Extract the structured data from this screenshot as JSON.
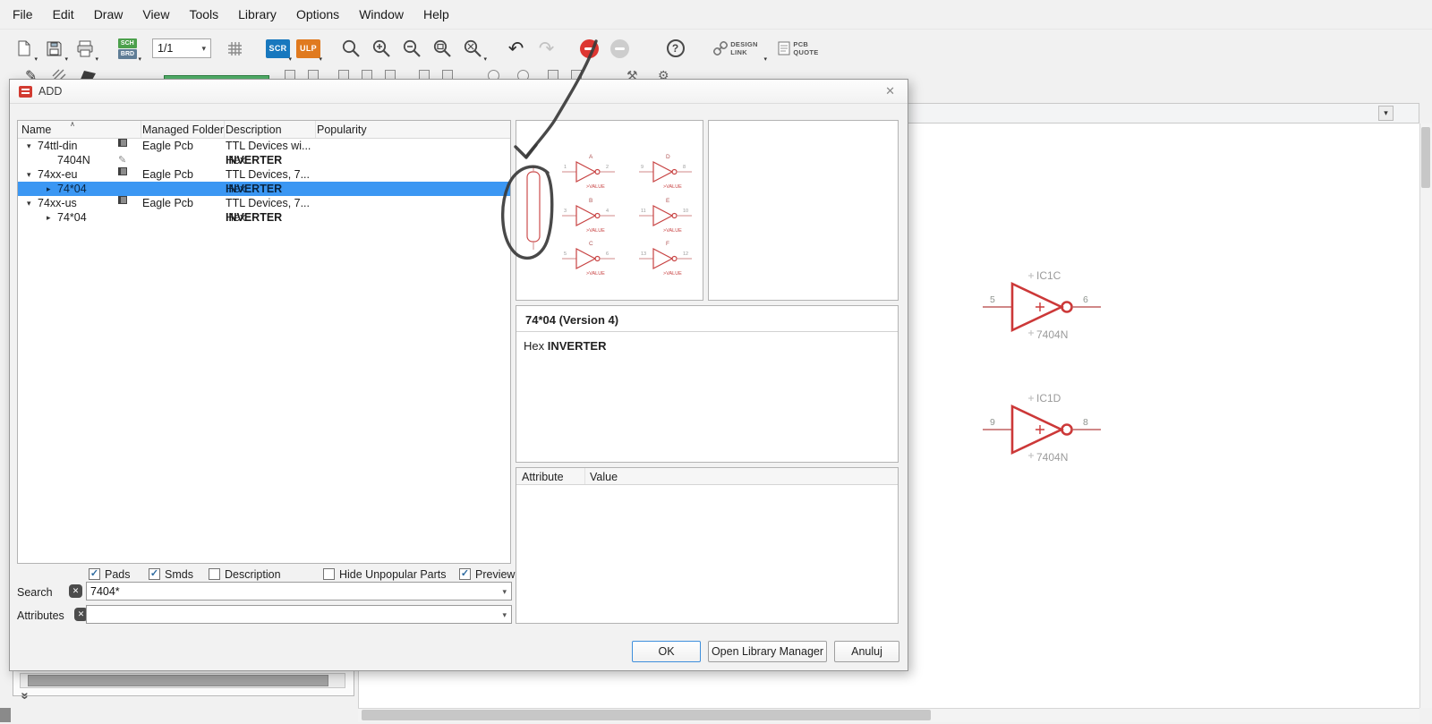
{
  "icons": {
    "dropdown": "▾",
    "close": "✕",
    "clear": "✕",
    "help": "?",
    "undo": "↶",
    "redo": "↷",
    "pencil": "✎",
    "sort": "∧",
    "collapse": "»",
    "check": "✓"
  },
  "menubar": {
    "items": [
      "File",
      "Edit",
      "Draw",
      "View",
      "Tools",
      "Library",
      "Options",
      "Window",
      "Help"
    ]
  },
  "toolbar": {
    "sheet_selector": "1/1",
    "sch_badge": "SCH",
    "brd_badge": "BRD",
    "scr_badge": "SCR",
    "ulp_badge": "ULP",
    "design_link_line1": "DESIGN",
    "design_link_line2": "LINK",
    "pcb_quote_line1": "PCB",
    "pcb_quote_line2": "QUOTE"
  },
  "dialog": {
    "title": "ADD",
    "columns": [
      "Name",
      "Managed Folder",
      "Description",
      "Popularity"
    ],
    "rows": [
      {
        "name": "74ttl-din",
        "folder": "Eagle Pcb",
        "desc_prefix": "TTL Devices wi...",
        "desc_bold": "",
        "selected": false
      },
      {
        "name": "7404N",
        "folder": "",
        "desc_prefix": "Hex ",
        "desc_bold": "INVERTER",
        "selected": false
      },
      {
        "name": "74xx-eu",
        "folder": "Eagle Pcb",
        "desc_prefix": "TTL Devices, 7...",
        "desc_bold": "",
        "selected": false
      },
      {
        "name": "74*04",
        "folder": "",
        "desc_prefix": "Hex ",
        "desc_bold": "INVERTER",
        "selected": true
      },
      {
        "name": "74xx-us",
        "folder": "Eagle Pcb",
        "desc_prefix": "TTL Devices, 7...",
        "desc_bold": "",
        "selected": false
      },
      {
        "name": "74*04",
        "folder": "",
        "desc_prefix": "Hex ",
        "desc_bold": "INVERTER",
        "selected": false
      }
    ],
    "preview": {
      "value_label": ">VALUE",
      "gates": [
        {
          "letter": "A",
          "pin_in": "1",
          "pin_out": "2"
        },
        {
          "letter": "B",
          "pin_in": "3",
          "pin_out": "4"
        },
        {
          "letter": "C",
          "pin_in": "5",
          "pin_out": "6"
        },
        {
          "letter": "D",
          "pin_in": "9",
          "pin_out": "8"
        },
        {
          "letter": "E",
          "pin_in": "11",
          "pin_out": "10"
        },
        {
          "letter": "F",
          "pin_in": "13",
          "pin_out": "12"
        }
      ]
    },
    "info": {
      "title": "74*04 (Version 4)",
      "desc_prefix": "Hex ",
      "desc_bold": "INVERTER"
    },
    "attributes_table": {
      "columns": [
        "Attribute",
        "Value"
      ]
    },
    "checkboxes": [
      {
        "label": "Pads",
        "checked": true
      },
      {
        "label": "Smds",
        "checked": true
      },
      {
        "label": "Description",
        "checked": false
      },
      {
        "label": "Hide Unpopular Parts",
        "checked": false
      },
      {
        "label": "Preview",
        "checked": true
      }
    ],
    "search_label": "Search",
    "search_value": "7404*",
    "attributes_label": "Attributes",
    "attributes_value": "",
    "buttons": {
      "ok": "OK",
      "library_manager": "Open Library Manager",
      "cancel": "Anuluj"
    }
  },
  "schematic": {
    "gates": [
      {
        "ref": "IC1C",
        "pin_in": "5",
        "pin_out": "6",
        "value": "7404N"
      },
      {
        "ref": "IC1D",
        "pin_in": "9",
        "pin_out": "8",
        "value": "7404N"
      }
    ]
  },
  "colors": {
    "selection_blue": "#3b97f3",
    "symbol_red": "#cc3838",
    "scr_badge_blue": "#1878be",
    "ulp_badge_orange": "#e07a1f",
    "stop_red": "#dd3631"
  }
}
